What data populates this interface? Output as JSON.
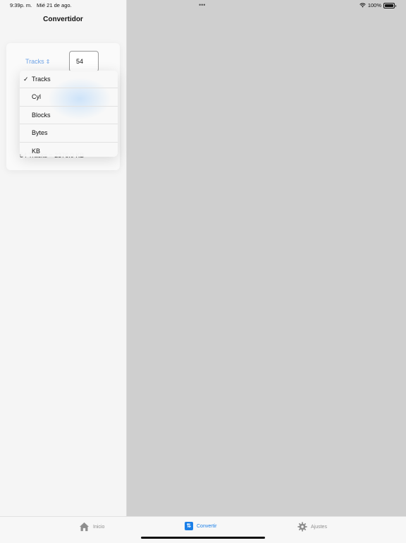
{
  "status_bar": {
    "time": "9:39p. m.",
    "date": "Mié 21 de ago.",
    "dots": "•••",
    "battery_label": "100%"
  },
  "sidebar": {
    "title": "Convertidor",
    "unit_picker_label": "Tracks",
    "value": "54",
    "result": "54 Tracks = 2376.0 KB"
  },
  "menu": {
    "selected": "Tracks",
    "items": [
      "Tracks",
      "Cyl",
      "Blocks",
      "Bytes",
      "KB"
    ]
  },
  "tabbar": {
    "items": [
      {
        "label": "Inicio",
        "icon": "home-icon",
        "active": false
      },
      {
        "label": "Convertir",
        "icon": "convert-icon",
        "active": true
      },
      {
        "label": "Ajustes",
        "icon": "gear-icon",
        "active": false
      }
    ]
  },
  "colors": {
    "accent": "#1a7fe8",
    "picker_text": "#6ea3e6",
    "detail_background": "#cfcfcf"
  }
}
